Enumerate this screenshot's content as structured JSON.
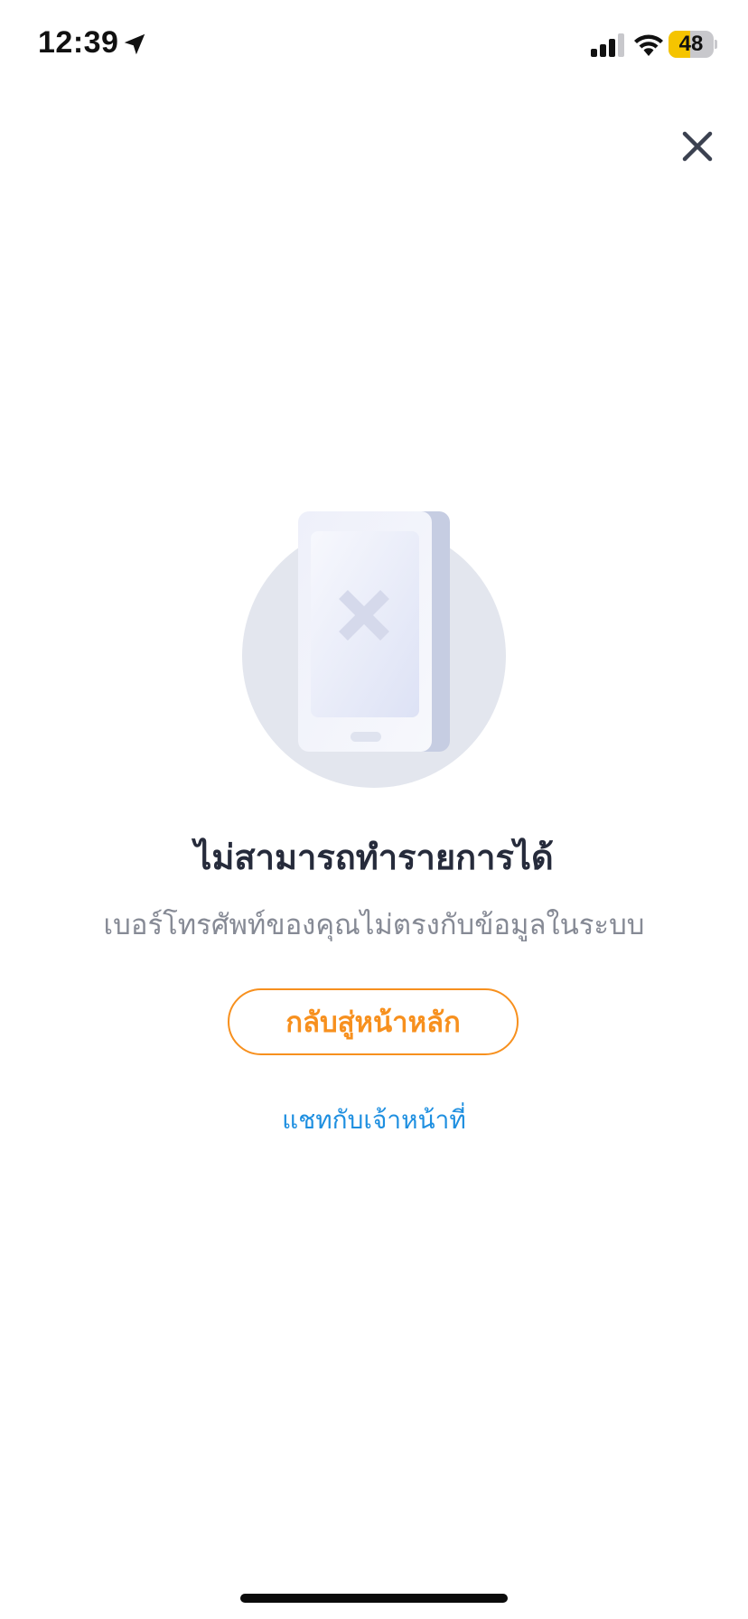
{
  "status_bar": {
    "time": "12:39",
    "battery_level": "48",
    "battery_fraction": 0.48,
    "icons": [
      "location-arrow-icon",
      "cellular-signal-icon",
      "wifi-icon",
      "battery-icon"
    ]
  },
  "header": {
    "close_icon": "close-icon"
  },
  "illustration": {
    "icon": "phone-error-icon"
  },
  "content": {
    "title": "ไม่สามารถทำรายการได้",
    "message": "เบอร์โทรศัพท์ของคุณไม่ตรงกับข้อมูลในระบบ"
  },
  "actions": {
    "home_button_label": "กลับสู่หน้าหลัก",
    "chat_link_label": "แชทกับเจ้าหน้าที่"
  },
  "colors": {
    "accent_orange": "#f7901e",
    "link_blue": "#1e8fe0",
    "title_text": "#262b3b",
    "body_text": "#868a95",
    "battery_yellow": "#f5c400"
  }
}
